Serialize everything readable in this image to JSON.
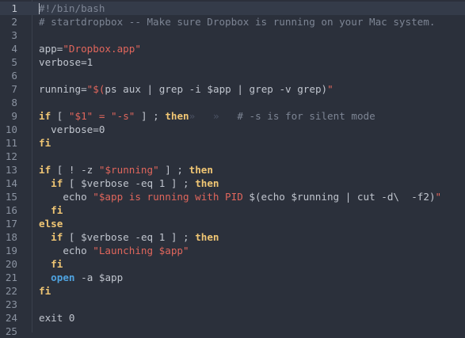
{
  "editor": {
    "current_line": 1,
    "colors": {
      "background": "#2b303b",
      "comment": "#7d8594",
      "string": "#e0665c",
      "variable": "#a3c285",
      "operator": "#b77fc9",
      "keyword": "#f0c674",
      "builtin": "#4fa3e0",
      "plain": "#c0c5ce"
    },
    "lines": [
      {
        "n": "1",
        "tokens": [
          [
            "comment",
            "#!/bin/bash"
          ]
        ]
      },
      {
        "n": "2",
        "tokens": [
          [
            "comment",
            "# startdropbox -- Make sure Dropbox is running on your Mac system."
          ]
        ]
      },
      {
        "n": "3",
        "tokens": []
      },
      {
        "n": "4",
        "tokens": [
          [
            "variable",
            "app"
          ],
          [
            "plain",
            "="
          ],
          [
            "string",
            "\"Dropbox.app\""
          ]
        ]
      },
      {
        "n": "5",
        "tokens": [
          [
            "variable",
            "verbose"
          ],
          [
            "plain",
            "=1"
          ]
        ]
      },
      {
        "n": "6",
        "tokens": []
      },
      {
        "n": "7",
        "tokens": [
          [
            "variable",
            "running"
          ],
          [
            "plain",
            "="
          ],
          [
            "string",
            "\"$("
          ],
          [
            "operator",
            "ps"
          ],
          [
            "plain",
            " aux "
          ],
          [
            "operator",
            "|"
          ],
          [
            "plain",
            " "
          ],
          [
            "operator",
            "grep"
          ],
          [
            "plain",
            " "
          ],
          [
            "operator",
            "-i"
          ],
          [
            "plain",
            " "
          ],
          [
            "variable",
            "$app"
          ],
          [
            "plain",
            " "
          ],
          [
            "operator",
            "|"
          ],
          [
            "plain",
            " "
          ],
          [
            "operator",
            "grep"
          ],
          [
            "plain",
            " "
          ],
          [
            "operator",
            "-v"
          ],
          [
            "plain",
            " grep)"
          ],
          [
            "string",
            "\""
          ]
        ]
      },
      {
        "n": "8",
        "tokens": []
      },
      {
        "n": "9",
        "tokens": [
          [
            "keyword",
            "if"
          ],
          [
            "plain",
            " [ "
          ],
          [
            "string",
            "\"$1\""
          ],
          [
            "plain",
            " "
          ],
          [
            "string",
            "="
          ],
          [
            "plain",
            " "
          ],
          [
            "string",
            "\"-s\""
          ],
          [
            "plain",
            " ] ; "
          ],
          [
            "keyword",
            "then"
          ],
          [
            "invis",
            "»   »   "
          ],
          [
            "comment",
            "# -s is for silent mode"
          ]
        ]
      },
      {
        "n": "10",
        "tokens": [
          [
            "plain",
            "  "
          ],
          [
            "variable",
            "verbose"
          ],
          [
            "plain",
            "=0"
          ]
        ]
      },
      {
        "n": "11",
        "tokens": [
          [
            "keyword",
            "fi"
          ]
        ]
      },
      {
        "n": "12",
        "tokens": []
      },
      {
        "n": "13",
        "tokens": [
          [
            "keyword",
            "if"
          ],
          [
            "plain",
            " [ ! "
          ],
          [
            "operator",
            "-z"
          ],
          [
            "plain",
            " "
          ],
          [
            "string",
            "\"$running\""
          ],
          [
            "plain",
            " ] ; "
          ],
          [
            "keyword",
            "then"
          ]
        ]
      },
      {
        "n": "14",
        "tokens": [
          [
            "plain",
            "  "
          ],
          [
            "keyword",
            "if"
          ],
          [
            "plain",
            " [ "
          ],
          [
            "variable",
            "$verbose"
          ],
          [
            "plain",
            " "
          ],
          [
            "operator",
            "-eq"
          ],
          [
            "plain",
            " 1 ] ; "
          ],
          [
            "keyword",
            "then"
          ]
        ]
      },
      {
        "n": "15",
        "tokens": [
          [
            "plain",
            "    echo "
          ],
          [
            "string",
            "\"$app is running with PID "
          ],
          [
            "plain",
            "$(echo "
          ],
          [
            "variable",
            "$running"
          ],
          [
            "plain",
            " "
          ],
          [
            "operator",
            "|"
          ],
          [
            "plain",
            " "
          ],
          [
            "operator",
            "cut"
          ],
          [
            "plain",
            " "
          ],
          [
            "operator",
            "-d\\"
          ],
          [
            "plain",
            "  "
          ],
          [
            "operator",
            "-f2"
          ],
          [
            "plain",
            ")"
          ],
          [
            "string",
            "\""
          ]
        ]
      },
      {
        "n": "16",
        "tokens": [
          [
            "plain",
            "  "
          ],
          [
            "keyword",
            "fi"
          ]
        ]
      },
      {
        "n": "17",
        "tokens": [
          [
            "keyword",
            "else"
          ]
        ]
      },
      {
        "n": "18",
        "tokens": [
          [
            "plain",
            "  "
          ],
          [
            "keyword",
            "if"
          ],
          [
            "plain",
            " [ "
          ],
          [
            "variable",
            "$verbose"
          ],
          [
            "plain",
            " "
          ],
          [
            "operator",
            "-eq"
          ],
          [
            "plain",
            " 1 ] ; "
          ],
          [
            "keyword",
            "then"
          ]
        ]
      },
      {
        "n": "19",
        "tokens": [
          [
            "plain",
            "    echo "
          ],
          [
            "string",
            "\"Launching $app\""
          ]
        ]
      },
      {
        "n": "20",
        "tokens": [
          [
            "plain",
            "  "
          ],
          [
            "keyword",
            "fi"
          ]
        ]
      },
      {
        "n": "21",
        "tokens": [
          [
            "plain",
            "  "
          ],
          [
            "builtin",
            "open"
          ],
          [
            "plain",
            " "
          ],
          [
            "operator",
            "-a"
          ],
          [
            "plain",
            " "
          ],
          [
            "variable",
            "$app"
          ]
        ]
      },
      {
        "n": "22",
        "tokens": [
          [
            "keyword",
            "fi"
          ]
        ]
      },
      {
        "n": "23",
        "tokens": []
      },
      {
        "n": "24",
        "tokens": [
          [
            "plain",
            "exit 0"
          ]
        ]
      },
      {
        "n": "25",
        "tokens": []
      }
    ]
  }
}
